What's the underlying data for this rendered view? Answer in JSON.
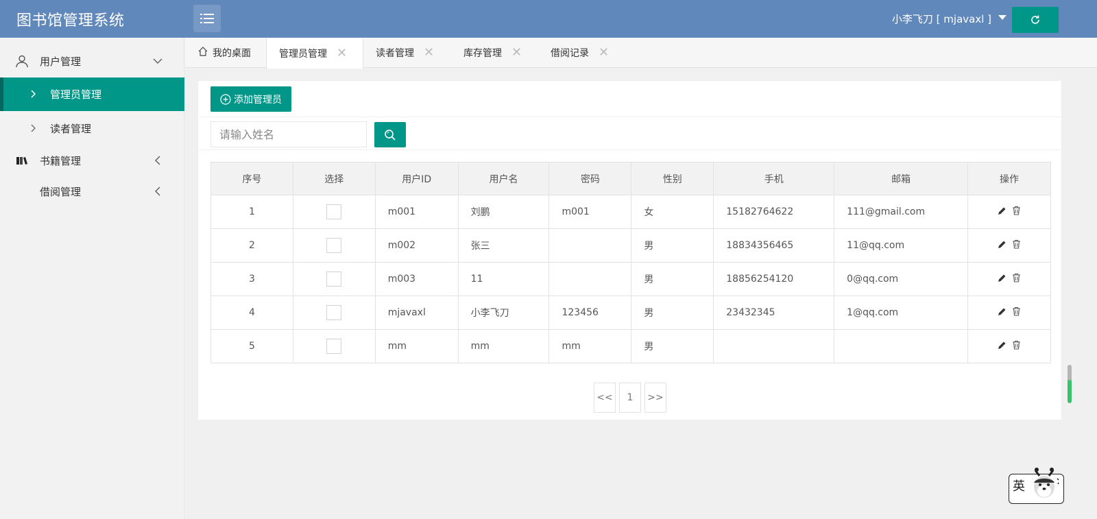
{
  "header": {
    "app_title": "图书馆管理系统",
    "user_display": "小李飞刀 [ mjavaxl ]"
  },
  "sidebar": {
    "groups": [
      {
        "label": "用户管理",
        "icon": "user-icon",
        "expanded": true
      },
      {
        "label": "书籍管理",
        "icon": "books-icon",
        "expanded": false
      },
      {
        "label": "借阅管理",
        "icon": "",
        "expanded": false
      }
    ],
    "sub_items": [
      {
        "label": "管理员管理",
        "active": true
      },
      {
        "label": "读者管理",
        "active": false
      }
    ]
  },
  "tabs": [
    {
      "label": "我的桌面",
      "icon": "home-icon",
      "closable": false
    },
    {
      "label": "管理员管理",
      "closable": true,
      "active": true
    },
    {
      "label": "读者管理",
      "closable": true
    },
    {
      "label": "库存管理",
      "closable": true
    },
    {
      "label": "借阅记录",
      "closable": true
    }
  ],
  "toolbar": {
    "add_label": "添加管理员"
  },
  "search": {
    "placeholder": "请输入姓名"
  },
  "table": {
    "columns": [
      "序号",
      "选择",
      "用户ID",
      "用户名",
      "密码",
      "性别",
      "手机",
      "邮箱",
      "操作"
    ],
    "rows": [
      {
        "index": "1",
        "user_id": "m001",
        "username": "刘鹏",
        "password": "m001",
        "gender": "女",
        "phone": "15182764622",
        "email": "111@gmail.com"
      },
      {
        "index": "2",
        "user_id": "m002",
        "username": "张三",
        "password": "",
        "gender": "男",
        "phone": "18834356465",
        "email": "11@qq.com"
      },
      {
        "index": "3",
        "user_id": "m003",
        "username": "11",
        "password": "",
        "gender": "男",
        "phone": "18856254120",
        "email": "0@qq.com"
      },
      {
        "index": "4",
        "user_id": "mjavaxl",
        "username": "小李飞刀",
        "password": "123456",
        "gender": "男",
        "phone": "23432345",
        "email": "1@qq.com"
      },
      {
        "index": "5",
        "user_id": "mm",
        "username": "mm",
        "password": "mm",
        "gender": "男",
        "phone": "",
        "email": ""
      }
    ]
  },
  "pagination": {
    "prev": "<<",
    "current": "1",
    "next": ">>"
  },
  "ime": {
    "label": "英"
  },
  "colors": {
    "header_bg": "#6088ba",
    "accent": "#009688",
    "sidebar_bg": "#f2f2f2"
  }
}
